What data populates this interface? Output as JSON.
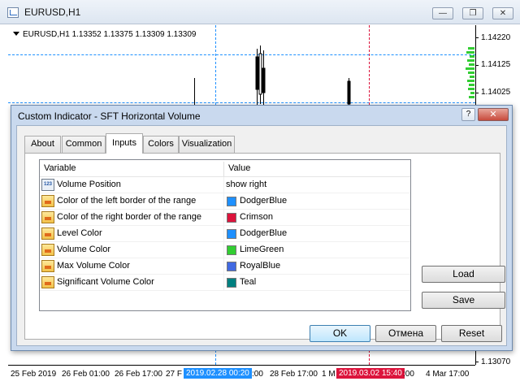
{
  "window": {
    "title": "EURUSD,H1",
    "controls": {
      "minimize": "—",
      "restore": "❐",
      "close": "✕"
    }
  },
  "chart": {
    "symbol_info": "EURUSD,H1  1.13352 1.13375 1.13309 1.13309",
    "price_labels": [
      "1.14220",
      "1.14125",
      "1.14025",
      "1.13070"
    ],
    "time_labels": [
      "25 Feb 2019",
      "26 Feb 01:00",
      "26 Feb 17:00",
      "27 F",
      ":00",
      "28 Feb 17:00",
      "1 M",
      ":00",
      "4 Mar 17:00"
    ],
    "time_markers": [
      {
        "text": "2019.02.28 00:20",
        "color": "#1e90ff"
      },
      {
        "text": "2019.03.02 15:40",
        "color": "#dc143c"
      }
    ],
    "colors": {
      "left_border": "#1e90ff",
      "right_border": "#dc143c",
      "level": "#1e90ff",
      "volume": "#32cd32"
    }
  },
  "dialog": {
    "title": "Custom Indicator - SFT Horizontal Volume",
    "help": "?",
    "close": "✕",
    "tabs": [
      "About",
      "Common",
      "Inputs",
      "Colors",
      "Visualization"
    ],
    "active_tab": "Inputs",
    "grid": {
      "headers": [
        "Variable",
        "Value"
      ],
      "rows": [
        {
          "icon": "integer-icon",
          "variable": "Volume Position",
          "value": "show right",
          "color": ""
        },
        {
          "icon": "color-param-icon",
          "variable": "Color of the left border of the range",
          "value": "DodgerBlue",
          "color": "#1e90ff"
        },
        {
          "icon": "color-param-icon",
          "variable": "Color of the right border of the range",
          "value": "Crimson",
          "color": "#dc143c"
        },
        {
          "icon": "color-param-icon",
          "variable": "Level Color",
          "value": "DodgerBlue",
          "color": "#1e90ff"
        },
        {
          "icon": "color-param-icon",
          "variable": "Volume Color",
          "value": "LimeGreen",
          "color": "#32cd32"
        },
        {
          "icon": "color-param-icon",
          "variable": "Max Volume Color",
          "value": "RoyalBlue",
          "color": "#4169e1"
        },
        {
          "icon": "color-param-icon",
          "variable": "Significant Volume Color",
          "value": "Teal",
          "color": "#008080"
        }
      ]
    },
    "buttons": {
      "load": "Load",
      "save": "Save",
      "ok": "OK",
      "cancel": "Отмена",
      "reset": "Reset"
    }
  }
}
